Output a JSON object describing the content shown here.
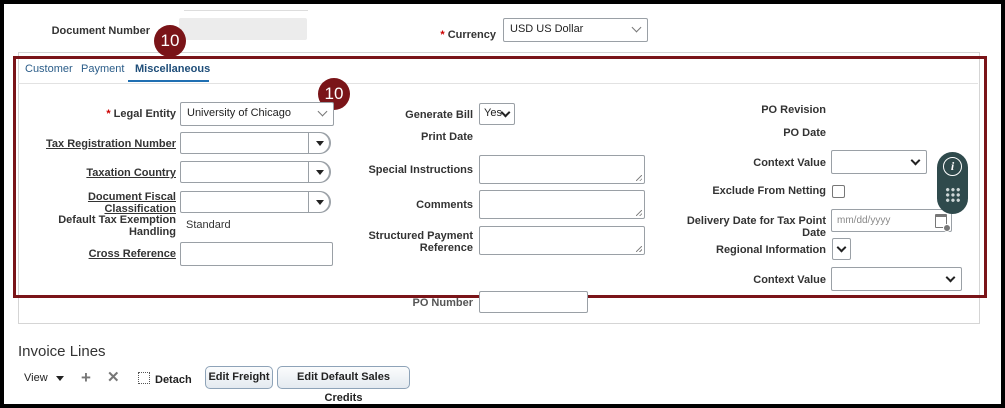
{
  "header": {
    "document_number_label": "Document Number",
    "document_number_value": "",
    "currency_label": "Currency",
    "currency_required": "*",
    "currency_value": "USD US Dollar"
  },
  "badges": [
    "10",
    "10"
  ],
  "tabs": [
    {
      "label": "Customer",
      "active": false
    },
    {
      "label": "Payment",
      "active": false
    },
    {
      "label": "Miscellaneous",
      "active": true
    }
  ],
  "col1": {
    "legal_entity_required": "*",
    "legal_entity_label": "Legal Entity",
    "legal_entity_value": "University of Chicago",
    "tax_registration_label": "Tax Registration Number",
    "taxation_country_label": "Taxation Country",
    "doc_fiscal_label_1": "Document Fiscal",
    "doc_fiscal_label_2": "Classification",
    "default_tax_label_1": "Default Tax Exemption",
    "default_tax_label_2": "Handling",
    "default_tax_value": "Standard",
    "cross_reference_label": "Cross Reference"
  },
  "col2": {
    "generate_bill_label": "Generate Bill",
    "generate_bill_value": "Yes",
    "print_date_label": "Print Date",
    "special_instructions_label": "Special Instructions",
    "comments_label": "Comments",
    "structured_payment_label_1": "Structured Payment",
    "structured_payment_label_2": "Reference",
    "po_number_label": "PO Number"
  },
  "col3": {
    "po_revision_label": "PO Revision",
    "po_date_label": "PO Date",
    "context_value_label": "Context Value",
    "exclude_netting_label": "Exclude From Netting",
    "delivery_date_label": "Delivery Date for Tax Point Date",
    "delivery_date_placeholder": "mm/dd/yyyy",
    "regional_info_label": "Regional Information",
    "context_value_label_2": "Context Value"
  },
  "invoice_lines": {
    "title": "Invoice Lines",
    "view_label": "View",
    "detach_label": "Detach",
    "edit_freight_label": "Edit Freight",
    "edit_sales_credits_label": "Edit Default Sales Credits"
  },
  "colors": {
    "highlight": "#7a1418",
    "link": "#2b5d89",
    "tab_active_underline": "#1f6fb2"
  }
}
